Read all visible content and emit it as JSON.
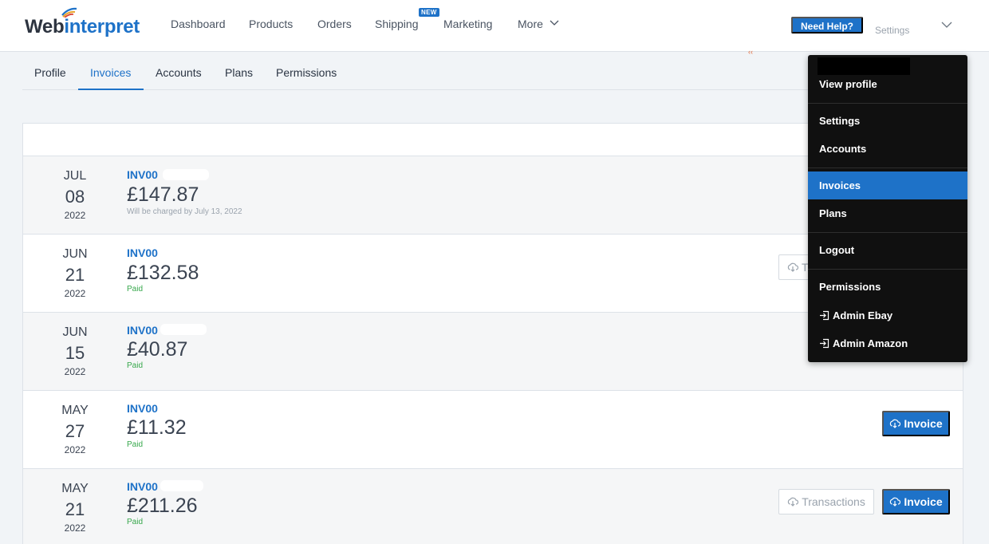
{
  "brand": {
    "logo_dark": "Web",
    "logo_blue": "interpret"
  },
  "nav": {
    "items": [
      {
        "label": "Dashboard"
      },
      {
        "label": "Products"
      },
      {
        "label": "Orders"
      },
      {
        "label": "Shipping"
      },
      {
        "label": "Marketing"
      },
      {
        "label": "More"
      }
    ],
    "new_badge": "NEW",
    "help_label": "Need Help?",
    "settings_label": "Settings"
  },
  "tabs": [
    {
      "label": "Profile"
    },
    {
      "label": "Invoices",
      "active": true
    },
    {
      "label": "Accounts"
    },
    {
      "label": "Plans"
    },
    {
      "label": "Permissions"
    }
  ],
  "invoices": [
    {
      "month": "JUL",
      "day": "08",
      "year": "2022",
      "number": "INV00",
      "amount": "£147.87",
      "status": "Will be charged by July 13, 2022",
      "paid": false
    },
    {
      "month": "JUN",
      "day": "21",
      "year": "2022",
      "number": "INV00",
      "amount": "£132.58",
      "status": "Paid",
      "paid": true
    },
    {
      "month": "JUN",
      "day": "15",
      "year": "2022",
      "number": "INV00",
      "amount": "£40.87",
      "status": "Paid",
      "paid": true
    },
    {
      "month": "MAY",
      "day": "27",
      "year": "2022",
      "number": "INV00",
      "amount": "£11.32",
      "status": "Paid",
      "paid": true
    },
    {
      "month": "MAY",
      "day": "21",
      "year": "2022",
      "number": "INV00",
      "amount": "£211.26",
      "status": "Paid",
      "paid": true
    }
  ],
  "buttons": {
    "transactions": "Transactions",
    "transactions_partial": "T",
    "invoice": "Invoice"
  },
  "stray_mark": "‹‹",
  "account_menu": {
    "items": [
      {
        "label": "View profile"
      },
      {
        "label": "Settings"
      },
      {
        "label": "Accounts"
      },
      {
        "label": "Invoices",
        "active": true
      },
      {
        "label": "Plans"
      },
      {
        "label": "Logout"
      },
      {
        "label": "Permissions"
      },
      {
        "label": "Admin Ebay",
        "icon": "sign-in-icon"
      },
      {
        "label": "Admin Amazon",
        "icon": "sign-in-icon"
      }
    ]
  },
  "colors": {
    "accent": "#1e72c8",
    "paid": "#37a84c",
    "menu_bg": "#101010"
  }
}
